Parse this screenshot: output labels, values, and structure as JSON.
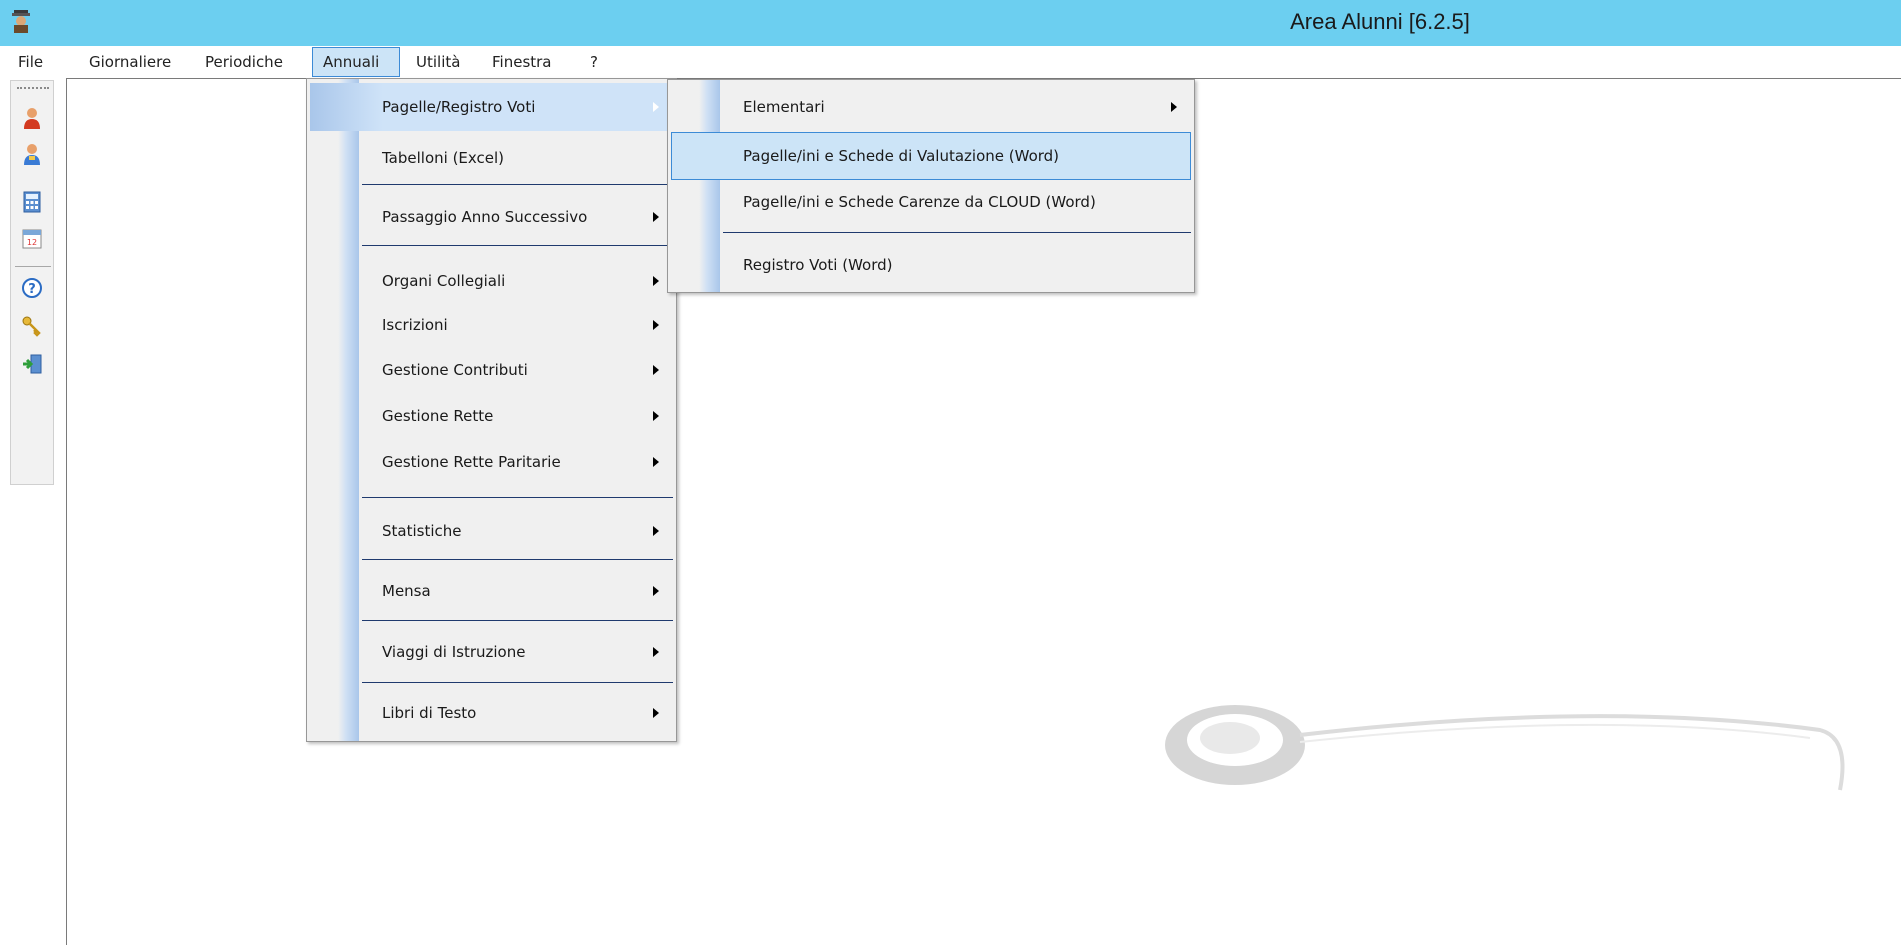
{
  "window": {
    "title": "Area Alunni [6.2.5]"
  },
  "menubar": {
    "items": [
      {
        "label": "File"
      },
      {
        "label": "Giornaliere"
      },
      {
        "label": "Periodiche"
      },
      {
        "label": "Annuali"
      },
      {
        "label": "Utilità"
      },
      {
        "label": "Finestra"
      },
      {
        "label": "?"
      }
    ],
    "active": "Annuali"
  },
  "toolbar": {
    "buttons": [
      {
        "icon": "user-red-icon"
      },
      {
        "icon": "user-blue-icon"
      },
      {
        "icon": "calculator-icon"
      },
      {
        "icon": "calendar-icon"
      },
      {
        "icon": "help-icon"
      },
      {
        "icon": "keys-icon"
      },
      {
        "icon": "exit-icon"
      }
    ]
  },
  "annuali_menu": {
    "items": [
      {
        "label": "Pagelle/Registro Voti",
        "submenu": true,
        "highlighted": true
      },
      {
        "label": "Tabelloni (Excel)",
        "submenu": false
      },
      {
        "label": "Passaggio Anno Successivo",
        "submenu": true
      },
      {
        "label": "Organi Collegiali",
        "submenu": true
      },
      {
        "label": "Iscrizioni",
        "submenu": true
      },
      {
        "label": "Gestione Contributi",
        "submenu": true
      },
      {
        "label": "Gestione Rette",
        "submenu": true
      },
      {
        "label": "Gestione Rette Paritarie",
        "submenu": true
      },
      {
        "label": "Statistiche",
        "submenu": true
      },
      {
        "label": "Mensa",
        "submenu": true
      },
      {
        "label": "Viaggi di Istruzione",
        "submenu": true
      },
      {
        "label": "Libri di Testo",
        "submenu": true
      }
    ]
  },
  "pagelle_submenu": {
    "items": [
      {
        "label": "Elementari",
        "submenu": true
      },
      {
        "label": "Pagelle/ini e Schede di Valutazione (Word)",
        "highlighted": true
      },
      {
        "label": "Pagelle/ini e Schede Carenze da CLOUD (Word)"
      },
      {
        "label": "Registro Voti (Word)"
      }
    ]
  },
  "colors": {
    "titlebar": "#6ccff0",
    "highlight": "#cce4f7",
    "highlight_border": "#3c8bd6",
    "menu_bg": "#f0f0f0"
  }
}
